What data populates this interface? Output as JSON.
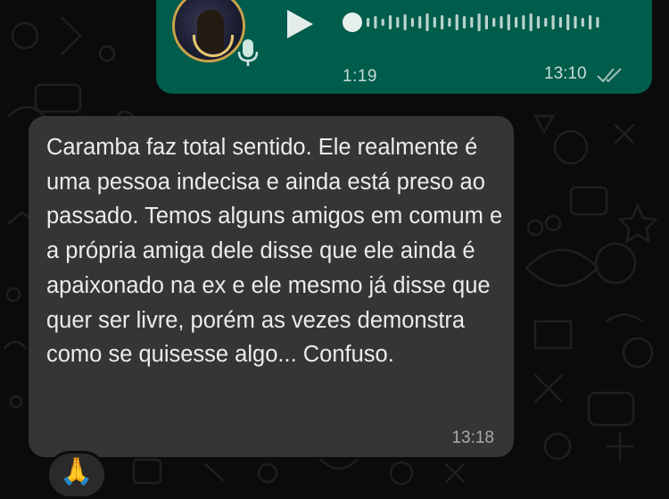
{
  "chat": {
    "outgoing_voice": {
      "duration": "1:19",
      "time": "13:10",
      "status": "sent-double-tick",
      "play_icon": "play-icon",
      "mic_icon": "mic-icon"
    },
    "incoming_message": {
      "text": "Caramba faz total sentido. Ele realmente é uma pessoa indecisa e ainda está preso ao passado. Temos alguns amigos em comum e a própria amiga dele disse que ele ainda é apaixonado na ex e ele mesmo já disse que quer ser livre, porém as vezes demonstra como se quisesse algo... Confuso.",
      "time": "13:18",
      "reaction": "🙏"
    }
  },
  "colors": {
    "background": "#0b0b0b",
    "outgoing_bubble": "#005c4b",
    "incoming_bubble": "#353535",
    "text": "#ececec",
    "meta_text": "#a9a9a9"
  }
}
